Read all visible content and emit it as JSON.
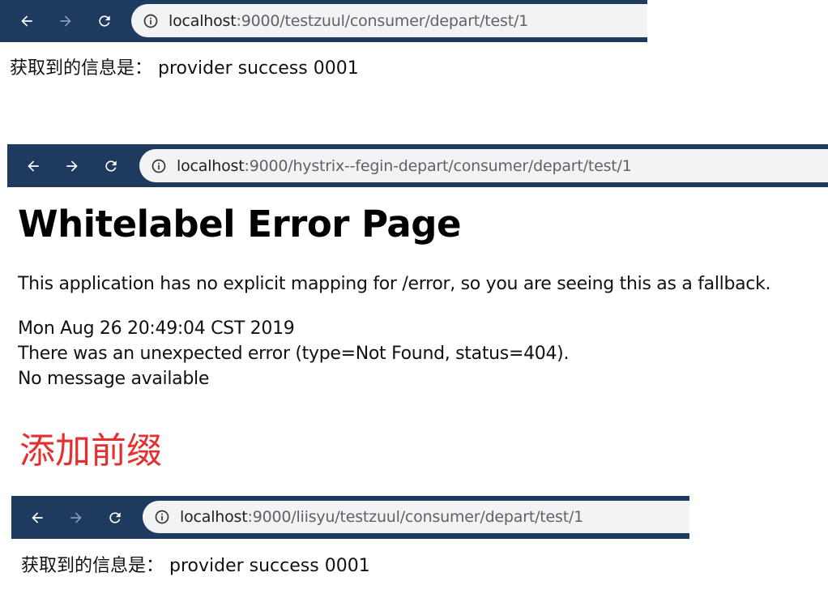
{
  "screenshot1": {
    "url_host": "localhost",
    "url_rest": ":9000/testzuul/consumer/depart/test/1",
    "result_text": "获取到的信息是： provider success 0001"
  },
  "screenshot2": {
    "url_host": "localhost",
    "url_rest": ":9000/hystrix--fegin-depart/consumer/depart/test/1",
    "error_title": "Whitelabel Error Page",
    "error_description": "This application has no explicit mapping for /error, so you are seeing this as a fallback.",
    "error_timestamp": "Mon Aug 26 20:49:04 CST 2019",
    "error_type_status": "There was an unexpected error (type=Not Found, status=404).",
    "error_message": "No message available"
  },
  "annotation": {
    "text": "添加前缀",
    "color": "#e53030"
  },
  "screenshot3": {
    "url_host": "localhost",
    "url_rest": ":9000/liisyu/testzuul/consumer/depart/test/1",
    "result_text": "获取到的信息是： provider success 0001"
  },
  "icons": {
    "back": "arrow-left-icon",
    "forward": "arrow-right-icon",
    "reload": "reload-icon",
    "info": "info-circle-icon"
  },
  "colors": {
    "toolbar": "#1e3a5f",
    "omnibox": "#f1f3f4",
    "annotation": "#e53030"
  }
}
